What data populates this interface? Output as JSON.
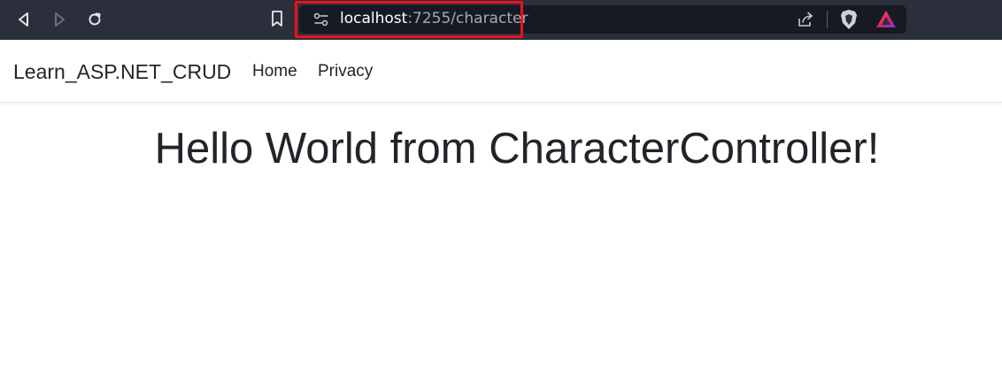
{
  "browser": {
    "url_host": "localhost",
    "url_path": ":7255/character",
    "toolbar_icons": [
      "back-icon",
      "forward-icon",
      "reload-icon",
      "bookmark-icon",
      "site-info-icon",
      "share-icon",
      "brave-shields-icon",
      "brave-rewards-icon"
    ],
    "highlight_color": "#e8141b"
  },
  "navbar": {
    "brand": "Learn_ASP.NET_CRUD",
    "links": [
      {
        "label": "Home"
      },
      {
        "label": "Privacy"
      }
    ]
  },
  "main": {
    "heading": "Hello World from CharacterController!"
  }
}
